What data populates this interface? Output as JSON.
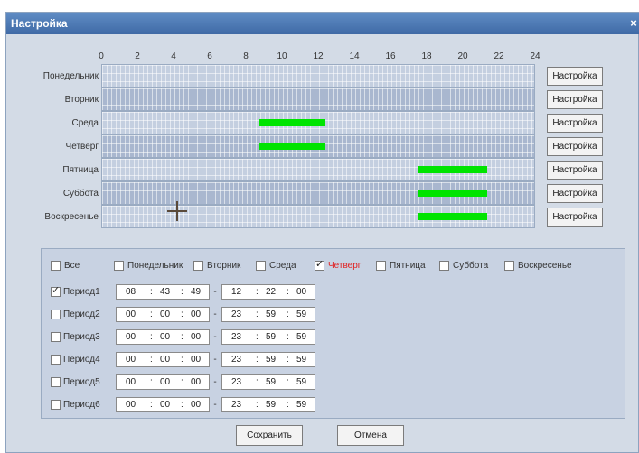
{
  "dialog": {
    "title": "Настройка",
    "close_label": "×"
  },
  "hours": [
    "0",
    "2",
    "4",
    "6",
    "8",
    "10",
    "12",
    "14",
    "16",
    "18",
    "20",
    "22",
    "24"
  ],
  "days": [
    {
      "label": "Понедельник",
      "button": "Настройка",
      "segments": []
    },
    {
      "label": "Вторник",
      "button": "Настройка",
      "segments": []
    },
    {
      "label": "Среда",
      "button": "Настройка",
      "segments": [
        [
          8.72,
          12.37
        ]
      ]
    },
    {
      "label": "Четверг",
      "button": "Настройка",
      "segments": [
        [
          8.72,
          12.37
        ]
      ]
    },
    {
      "label": "Пятница",
      "button": "Настройка",
      "segments": [
        [
          17.5,
          21.3
        ]
      ]
    },
    {
      "label": "Суббота",
      "button": "Настройка",
      "segments": [
        [
          17.5,
          21.3
        ]
      ]
    },
    {
      "label": "Воскресенье",
      "button": "Настройка",
      "segments": [
        [
          17.5,
          21.3
        ]
      ]
    }
  ],
  "segment_color": "#00e400",
  "checkboxes": [
    {
      "label": "Все",
      "checked": false
    },
    {
      "label": "Понедельник",
      "checked": false
    },
    {
      "label": "Вторник",
      "checked": false
    },
    {
      "label": "Среда",
      "checked": false
    },
    {
      "label": "Четверг",
      "checked": true
    },
    {
      "label": "Пятница",
      "checked": false
    },
    {
      "label": "Суббота",
      "checked": false
    },
    {
      "label": "Воскресенье",
      "checked": false
    }
  ],
  "periods": [
    {
      "label": "Период1",
      "checked": true,
      "start": [
        "08",
        "43",
        "49"
      ],
      "end": [
        "12",
        "22",
        "00"
      ]
    },
    {
      "label": "Период2",
      "checked": false,
      "start": [
        "00",
        "00",
        "00"
      ],
      "end": [
        "23",
        "59",
        "59"
      ]
    },
    {
      "label": "Период3",
      "checked": false,
      "start": [
        "00",
        "00",
        "00"
      ],
      "end": [
        "23",
        "59",
        "59"
      ]
    },
    {
      "label": "Период4",
      "checked": false,
      "start": [
        "00",
        "00",
        "00"
      ],
      "end": [
        "23",
        "59",
        "59"
      ]
    },
    {
      "label": "Период5",
      "checked": false,
      "start": [
        "00",
        "00",
        "00"
      ],
      "end": [
        "23",
        "59",
        "59"
      ]
    },
    {
      "label": "Период6",
      "checked": false,
      "start": [
        "00",
        "00",
        "00"
      ],
      "end": [
        "23",
        "59",
        "59"
      ]
    }
  ],
  "time_separator": ":",
  "range_separator": "-",
  "footer": {
    "save": "Сохранить",
    "cancel": "Отмена"
  }
}
